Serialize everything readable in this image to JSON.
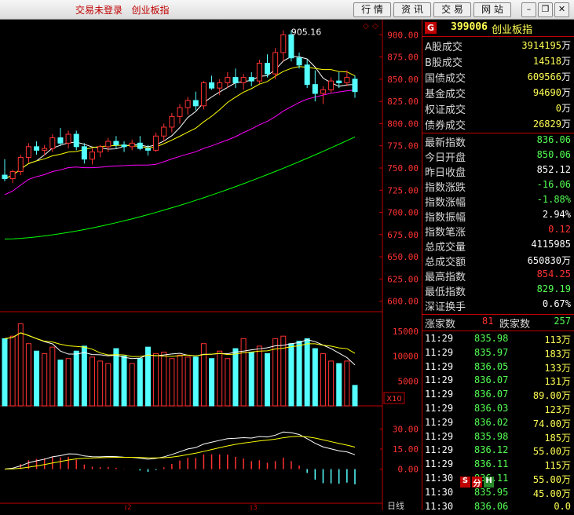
{
  "titlebar": {
    "status": "交易未登录",
    "title": "创业板指",
    "buttons": [
      "行 情",
      "资 讯",
      "交 易",
      "网 站"
    ],
    "window_controls": [
      "minimize-icon",
      "restore-icon",
      "close-icon"
    ]
  },
  "chart": {
    "peak_label": "905.16",
    "price_axis": [
      "900.00",
      "875.00",
      "850.00",
      "825.00",
      "800.00",
      "775.00",
      "750.00",
      "725.00",
      "700.00",
      "675.00",
      "650.00",
      "625.00",
      "600.00"
    ],
    "volume_axis": [
      "15000",
      "10000",
      "5000"
    ],
    "volume_unit": "X10",
    "macd_axis": [
      "30.00",
      "15.00",
      "0.00"
    ],
    "period_label": "日线",
    "month_markers": [
      "2",
      "3"
    ],
    "colors": {
      "up": "#ff3232",
      "down": "#54ffff",
      "ma1": "#ffffff",
      "ma2": "#ffff00",
      "ma3": "#ff00ff",
      "ma4": "#00ff00"
    }
  },
  "chart_data": {
    "type": "candlestick",
    "ylim": [
      590,
      910
    ],
    "ohlc": [
      [
        742,
        760,
        735,
        738
      ],
      [
        738,
        748,
        733,
        746
      ],
      [
        746,
        765,
        742,
        762
      ],
      [
        762,
        778,
        756,
        774
      ],
      [
        774,
        780,
        765,
        770
      ],
      [
        770,
        776,
        764,
        772
      ],
      [
        772,
        788,
        768,
        784
      ],
      [
        784,
        795,
        775,
        778
      ],
      [
        778,
        792,
        772,
        788
      ],
      [
        788,
        792,
        770,
        774
      ],
      [
        774,
        778,
        755,
        760
      ],
      [
        760,
        772,
        754,
        768
      ],
      [
        768,
        776,
        762,
        774
      ],
      [
        774,
        784,
        768,
        780
      ],
      [
        780,
        786,
        772,
        776
      ],
      [
        776,
        780,
        768,
        774
      ],
      [
        774,
        782,
        770,
        778
      ],
      [
        778,
        786,
        770,
        772
      ],
      [
        772,
        776,
        764,
        770
      ],
      [
        770,
        790,
        768,
        786
      ],
      [
        786,
        800,
        780,
        796
      ],
      [
        796,
        812,
        790,
        808
      ],
      [
        808,
        822,
        800,
        818
      ],
      [
        818,
        830,
        810,
        826
      ],
      [
        826,
        836,
        815,
        820
      ],
      [
        820,
        848,
        816,
        846
      ],
      [
        846,
        854,
        838,
        840
      ],
      [
        840,
        850,
        832,
        846
      ],
      [
        846,
        858,
        840,
        852
      ],
      [
        852,
        862,
        840,
        846
      ],
      [
        846,
        856,
        838,
        852
      ],
      [
        852,
        858,
        842,
        848
      ],
      [
        848,
        872,
        845,
        868
      ],
      [
        868,
        878,
        852,
        856
      ],
      [
        856,
        885,
        850,
        880
      ],
      [
        880,
        905,
        870,
        900
      ],
      [
        900,
        905,
        870,
        874
      ],
      [
        874,
        880,
        862,
        866
      ],
      [
        866,
        872,
        840,
        844
      ],
      [
        844,
        860,
        825,
        834
      ],
      [
        834,
        842,
        822,
        838
      ],
      [
        838,
        852,
        835,
        848
      ],
      [
        848,
        858,
        840,
        846
      ],
      [
        846,
        860,
        842,
        852
      ],
      [
        850,
        854,
        829,
        836
      ]
    ],
    "volume": [
      13500,
      14000,
      16500,
      12500,
      11000,
      10500,
      11800,
      9200,
      9500,
      11000,
      12000,
      9800,
      9000,
      8500,
      11500,
      10000,
      8500,
      9500,
      11800,
      10500,
      10800,
      9500,
      10200,
      9800,
      9800,
      12500,
      9500,
      11000,
      9500,
      11500,
      13500,
      10800,
      12000,
      10500,
      13500,
      14000,
      12500,
      13000,
      13500,
      11500,
      10500,
      9000,
      8500,
      9000,
      4115.985
    ]
  },
  "panel": {
    "code_badge": "G",
    "code": "399006",
    "name": "创业板指",
    "volumes": [
      {
        "label": "A股成交",
        "value": "3914195",
        "unit": "万"
      },
      {
        "label": "B股成交",
        "value": "14518",
        "unit": "万"
      },
      {
        "label": "国债成交",
        "value": "609566",
        "unit": "万"
      },
      {
        "label": "基金成交",
        "value": "94690",
        "unit": "万"
      },
      {
        "label": "权证成交",
        "value": "0",
        "unit": "万"
      },
      {
        "label": "债券成交",
        "value": "26829",
        "unit": "万"
      }
    ],
    "stats": [
      {
        "label": "最新指数",
        "value": "836.06",
        "color": "#54ff54"
      },
      {
        "label": "今日开盘",
        "value": "850.06",
        "color": "#54ff54"
      },
      {
        "label": "昨日收盘",
        "value": "852.12",
        "color": "#ffffff"
      },
      {
        "label": "指数涨跌",
        "value": "-16.06",
        "color": "#54ff54"
      },
      {
        "label": "指数涨幅",
        "value": "-1.88%",
        "color": "#54ff54"
      },
      {
        "label": "指数振幅",
        "value": "2.94%",
        "color": "#ffffff"
      },
      {
        "label": "指数笔涨",
        "value": "0.12",
        "color": "#ff3232"
      },
      {
        "label": "总成交量",
        "value": "4115985",
        "color": "#ffffff"
      },
      {
        "label": "总成交额",
        "value": "650830万",
        "color": "#ffffff"
      },
      {
        "label": "最高指数",
        "value": "854.25",
        "color": "#ff3232"
      },
      {
        "label": "最低指数",
        "value": "829.19",
        "color": "#54ff54"
      },
      {
        "label": "深证换手",
        "value": "0.67%",
        "color": "#ffffff"
      }
    ],
    "breadth": {
      "up_label": "涨家数",
      "up": "81",
      "down_label": "跌家数",
      "down": "257"
    },
    "ticks": [
      {
        "time": "11:29",
        "price": "835.98",
        "vol": "113万"
      },
      {
        "time": "11:29",
        "price": "835.97",
        "vol": "183万"
      },
      {
        "time": "11:29",
        "price": "836.05",
        "vol": "133万"
      },
      {
        "time": "11:29",
        "price": "836.07",
        "vol": "131万"
      },
      {
        "time": "11:29",
        "price": "836.07",
        "vol": "89.00万"
      },
      {
        "time": "11:29",
        "price": "836.03",
        "vol": "123万"
      },
      {
        "time": "11:29",
        "price": "836.02",
        "vol": "74.00万"
      },
      {
        "time": "11:29",
        "price": "835.98",
        "vol": "185万"
      },
      {
        "time": "11:29",
        "price": "836.12",
        "vol": "55.00万"
      },
      {
        "time": "11:29",
        "price": "836.11",
        "vol": "115万"
      },
      {
        "time": "11:30",
        "price": "836.11",
        "vol": "55.00万"
      },
      {
        "time": "11:30",
        "price": "835.95",
        "vol": "45.00万"
      },
      {
        "time": "11:30",
        "price": "836.06",
        "vol": "0.0"
      }
    ],
    "tags": [
      "S",
      "分",
      "H"
    ]
  }
}
